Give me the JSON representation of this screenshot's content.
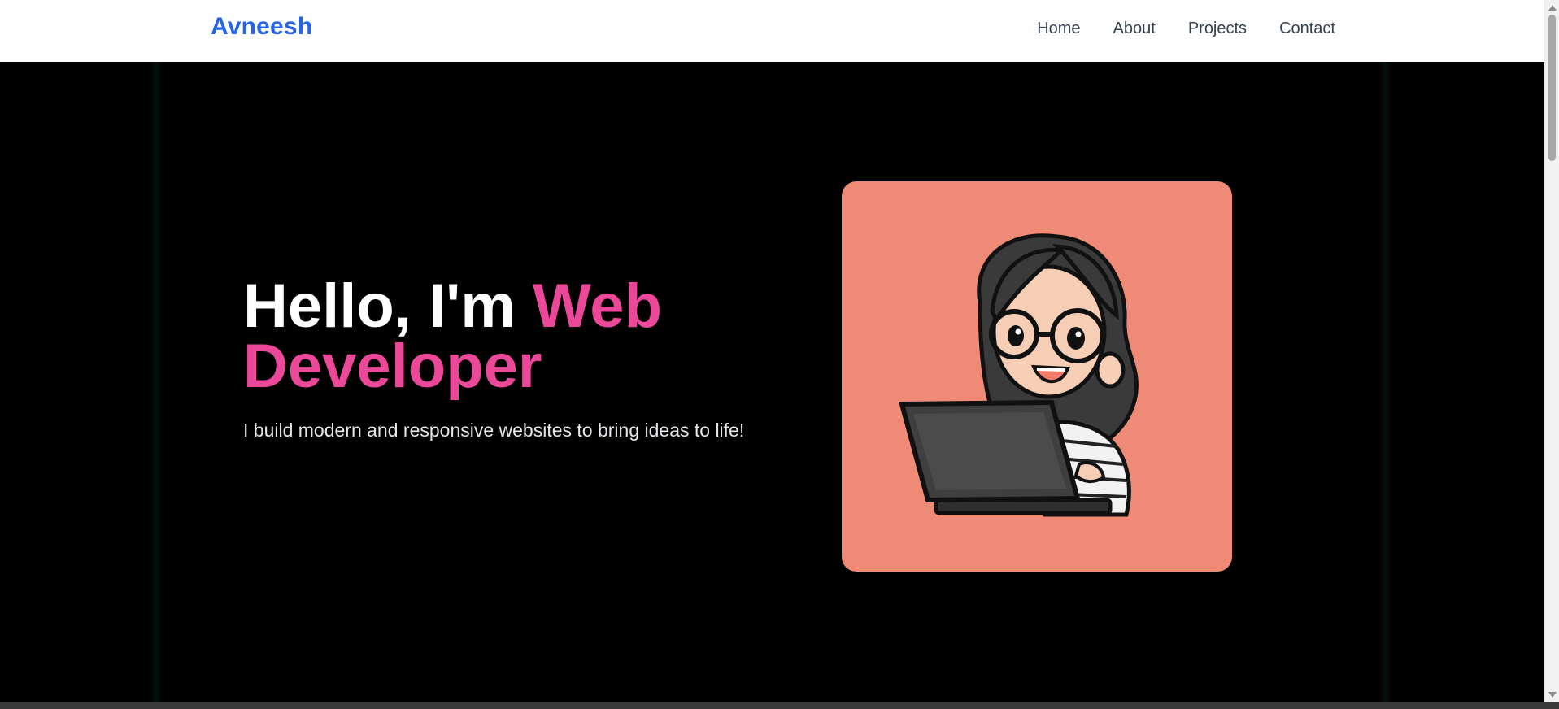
{
  "nav": {
    "brand": "Avneesh",
    "links": [
      {
        "label": "Home"
      },
      {
        "label": "About"
      },
      {
        "label": "Projects"
      },
      {
        "label": "Contact"
      }
    ]
  },
  "hero": {
    "headline_prefix": "Hello, I'm",
    "headline_accent": "Web Developer",
    "subtitle": "I build modern and responsive websites to bring ideas to life!"
  },
  "colors": {
    "brand": "#2563eb",
    "accent": "#ec4899",
    "card_bg": "#ef8a77",
    "hero_bg": "#000000"
  },
  "icons": [
    "developer-avatar-illustration"
  ]
}
